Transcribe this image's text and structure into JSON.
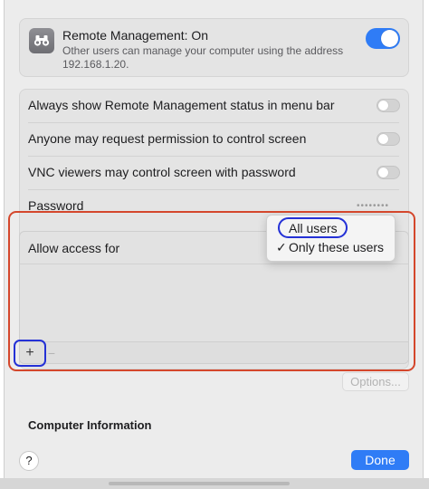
{
  "remote_management": {
    "title": "Remote Management: On",
    "description": "Other users can manage your computer using the address 192.168.1.20.",
    "enabled": true,
    "icon": "binoculars-icon"
  },
  "options": [
    {
      "label": "Always show Remote Management status in menu bar",
      "enabled": false
    },
    {
      "label": "Anyone may request permission to control screen",
      "enabled": false
    },
    {
      "label": "VNC viewers may control screen with password",
      "enabled": false
    }
  ],
  "password": {
    "label": "Password",
    "value": "••••••••"
  },
  "access": {
    "label": "Allow access for",
    "add_button": "+",
    "remove_button": "−"
  },
  "access_menu": {
    "items": [
      {
        "label": "All users",
        "checked": false
      },
      {
        "label": "Only these users",
        "checked": true
      }
    ],
    "checkmark": "✓"
  },
  "options_button": "Options...",
  "computer_info": {
    "title": "Computer Information"
  },
  "footer": {
    "help_button": "?",
    "done_button": "Done"
  },
  "colors": {
    "accent": "#2f7cf6",
    "annotation_red": "#d4472c",
    "annotation_blue": "#2431d6"
  }
}
